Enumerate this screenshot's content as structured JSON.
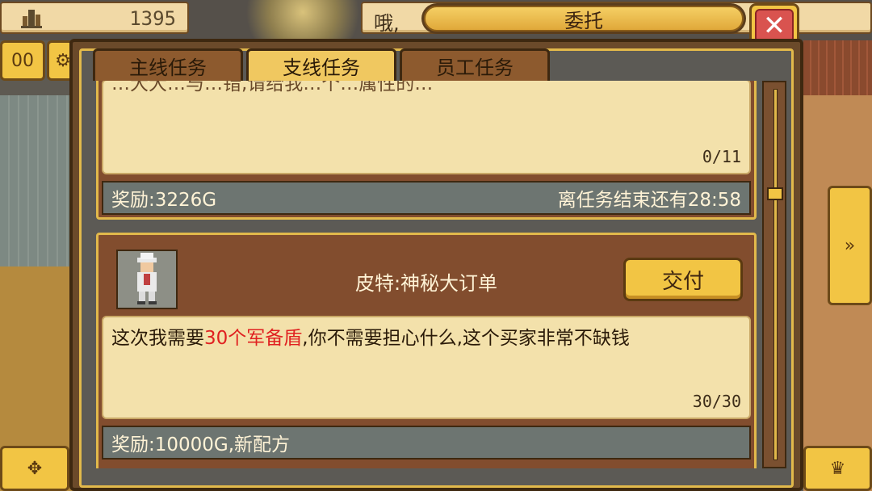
{
  "header": {
    "coins": "1395",
    "message": "哦,",
    "title": "委托"
  },
  "side": {
    "btn_00": "00"
  },
  "tabs": [
    {
      "label": "主线任务",
      "active": false
    },
    {
      "label": "支线任务",
      "active": true
    },
    {
      "label": "员工任务",
      "active": false
    }
  ],
  "tasks": [
    {
      "description_partial": "…大大…与…错,请给我…个…属性的…",
      "progress": "0/11",
      "reward": "奖励:3226G",
      "time_left": "离任务结束还有28:58"
    },
    {
      "title": "皮特:神秘大订单",
      "deliver_label": "交付",
      "desc_prefix": "这次我需要",
      "desc_highlight": "30个军备盾",
      "desc_suffix": ",你不需要担心什么,这个买家非常不缺钱",
      "progress": "30/30",
      "reward": "奖励:10000G,新配方"
    }
  ],
  "colors": {
    "accent_gold": "#f2c544",
    "highlight_red": "#e02020",
    "close_red": "#d9534f"
  }
}
